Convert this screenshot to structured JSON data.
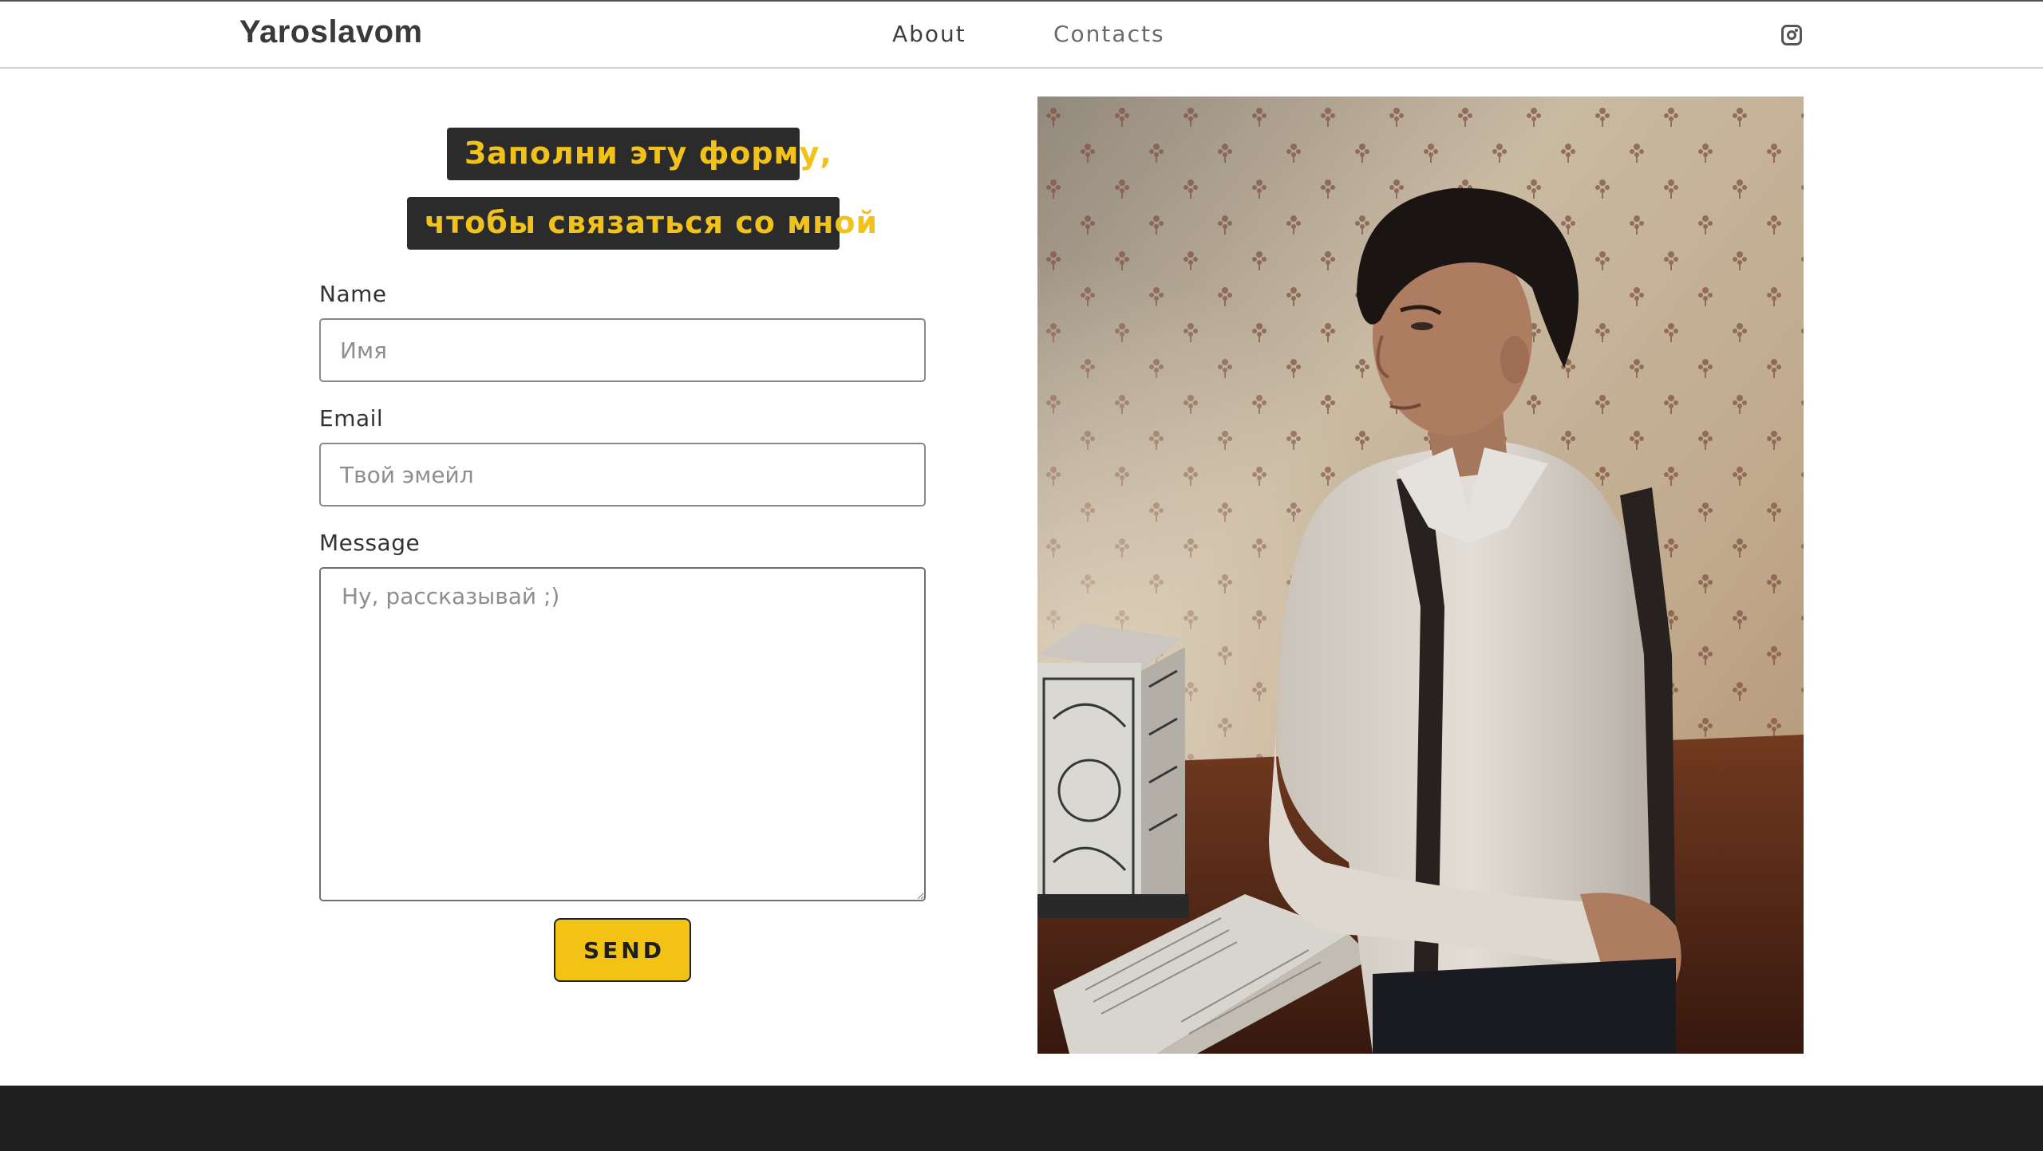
{
  "header": {
    "logo": "Yaroslavom",
    "nav": [
      {
        "label": "About"
      },
      {
        "label": "Contacts"
      }
    ],
    "social_icon": "instagram-icon"
  },
  "form": {
    "heading_line1": "Заполни эту форму,",
    "heading_line2": "чтобы связаться со мной",
    "name_label": "Name",
    "name_placeholder": "Имя",
    "email_label": "Email",
    "email_placeholder": "Твой эмейл",
    "message_label": "Message",
    "message_placeholder": "Ну, рассказывай ;)",
    "send_label": "SEND"
  },
  "colors": {
    "accent": "#f2c314",
    "heading_bg": "#2b2b2b",
    "footer_bg": "#1f1f1f"
  }
}
